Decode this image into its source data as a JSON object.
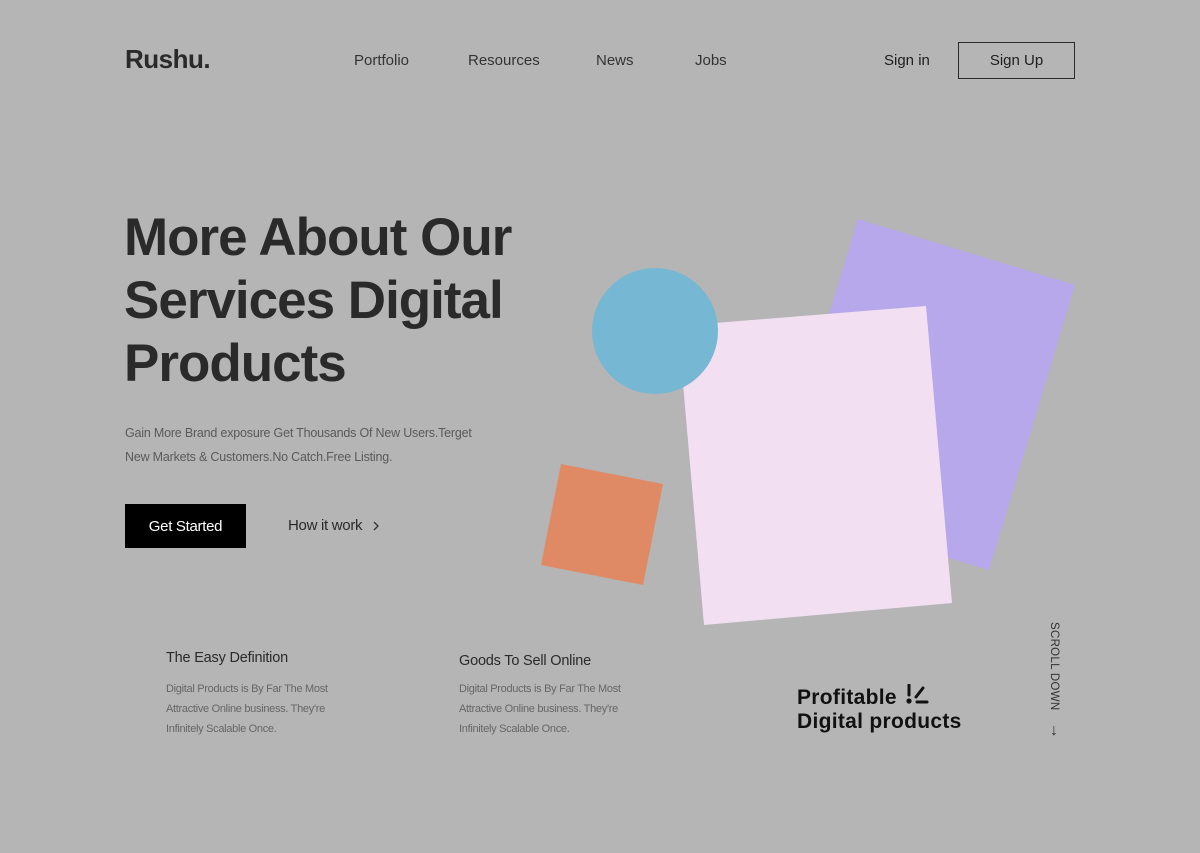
{
  "brand": {
    "logo": "Rushu."
  },
  "nav": {
    "links": [
      {
        "label": "Portfolio"
      },
      {
        "label": "Resources"
      },
      {
        "label": "News"
      },
      {
        "label": "Jobs"
      }
    ],
    "signin_label": "Sign in",
    "signup_label": "Sign Up"
  },
  "hero": {
    "title_lines": [
      "More About Our",
      "Services Digital",
      "Products"
    ],
    "description_lines": [
      "Gain More Brand exposure Get Thousands Of New Users.Terget",
      "New Markets & Customers.No Catch.Free Listing."
    ],
    "primary_cta": "Get Started",
    "secondary_cta": "How it work",
    "secondary_icon": "chevron-right-icon"
  },
  "shapes": {
    "colors": {
      "purple": "#b6a8ea",
      "pink": "#f2e0f2",
      "blue": "#76b8d3",
      "orange": "#df8a65"
    }
  },
  "features": [
    {
      "title": "The Easy Definition",
      "text_lines": [
        "Digital Products is By Far The Most",
        "Attractive Online business. They're",
        "Infinitely Scalable Once."
      ]
    },
    {
      "title": "Goods To Sell Online",
      "text_lines": [
        "Digital Products is By Far The Most",
        "Attractive Online business. They're",
        "Infinitely Scalable Once."
      ]
    }
  ],
  "promo": {
    "lines": [
      "Profitable",
      "Digital products"
    ],
    "icon": "sparkle-icon"
  },
  "scroll": {
    "label": "SCROLL DOWN",
    "arrow": "↓"
  },
  "colors": {
    "background": "#b5b5b5",
    "text": "#2a2a2a",
    "primary_button": "#000000"
  }
}
